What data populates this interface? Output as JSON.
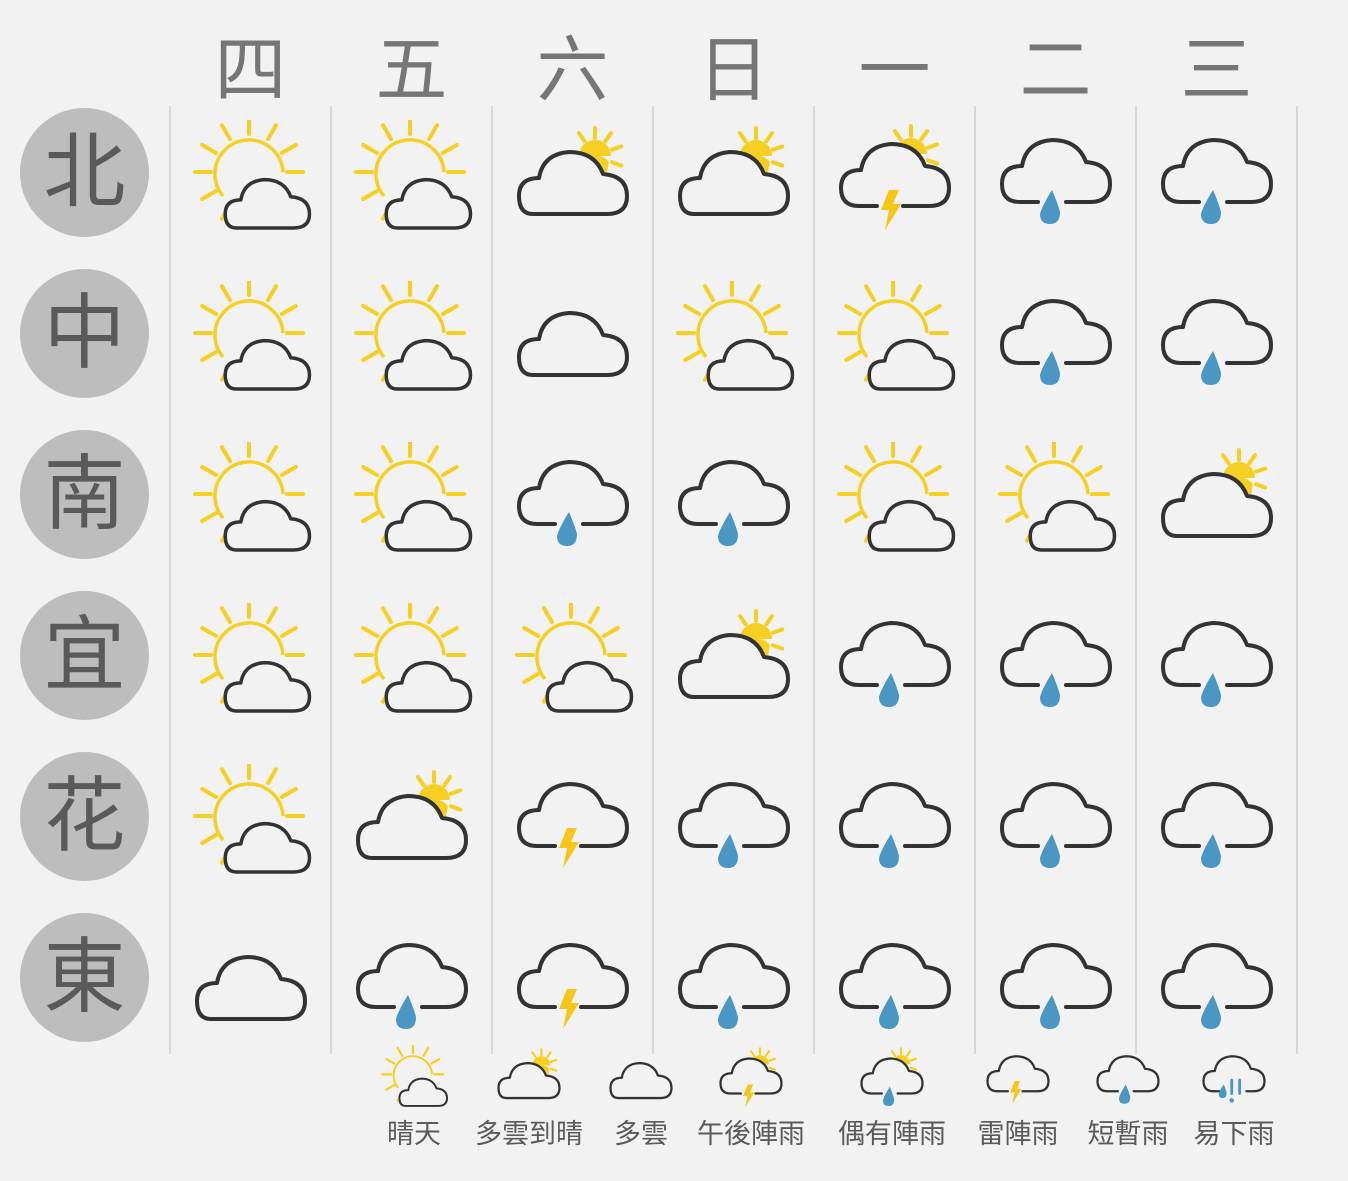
{
  "days": [
    "四",
    "五",
    "六",
    "日",
    "一",
    "二",
    "三"
  ],
  "regions": [
    "北",
    "中",
    "南",
    "宜",
    "花",
    "東"
  ],
  "colors": {
    "sun": "#f5d023",
    "cloud_stroke": "#333333",
    "raindrop": "#4a97c4",
    "lightning": "#f5c518",
    "region_circle": "#bdbdbd",
    "text": "#767676"
  },
  "forecast": [
    [
      "sunny",
      "sunny",
      "cloudy-sun",
      "cloudy-sun",
      "afternoon-thunder",
      "brief-rain",
      "brief-rain"
    ],
    [
      "sunny",
      "sunny",
      "cloudy",
      "sunny",
      "sunny",
      "brief-rain",
      "brief-rain"
    ],
    [
      "sunny",
      "sunny",
      "brief-rain",
      "brief-rain",
      "sunny",
      "sunny",
      "cloudy-sun"
    ],
    [
      "sunny",
      "sunny",
      "sunny",
      "cloudy-sun",
      "brief-rain",
      "brief-rain",
      "brief-rain"
    ],
    [
      "sunny",
      "cloudy-sun",
      "thunderstorm",
      "brief-rain",
      "brief-rain",
      "brief-rain",
      "brief-rain"
    ],
    [
      "cloudy",
      "brief-rain",
      "thunderstorm",
      "brief-rain",
      "brief-rain",
      "brief-rain",
      "brief-rain"
    ]
  ],
  "legend": [
    {
      "icon": "sunny",
      "label": "晴天"
    },
    {
      "icon": "cloudy-sun",
      "label": "多雲到晴"
    },
    {
      "icon": "cloudy",
      "label": "多雲"
    },
    {
      "icon": "afternoon-thunder",
      "label": "午後陣雨"
    },
    {
      "icon": "occasional-rain",
      "label": "偶有陣雨"
    },
    {
      "icon": "thunderstorm",
      "label": "雷陣雨"
    },
    {
      "icon": "brief-rain",
      "label": "短暫雨"
    },
    {
      "icon": "rain-easy",
      "label": "易下雨"
    }
  ]
}
